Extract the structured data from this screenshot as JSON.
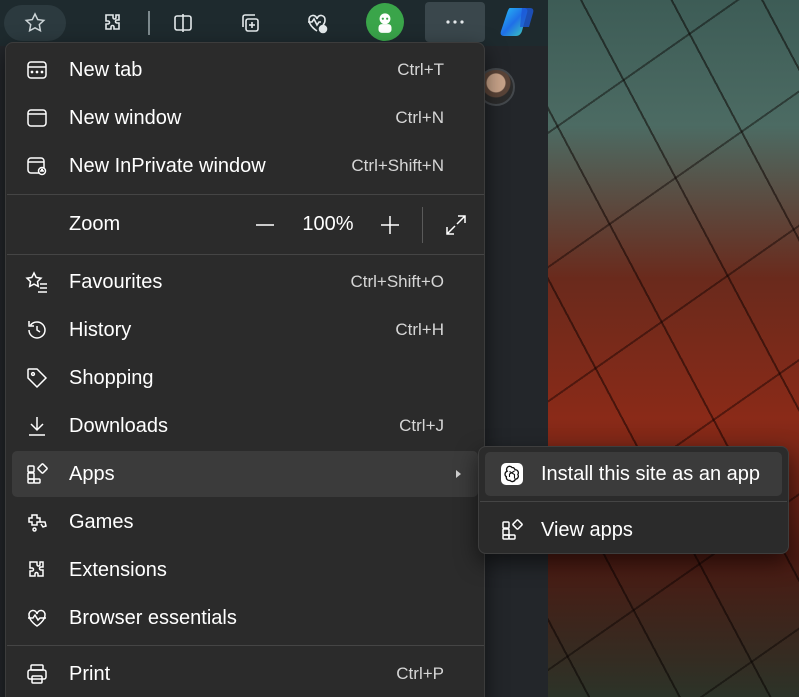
{
  "menu": {
    "items": [
      {
        "label": "New tab",
        "shortcut": "Ctrl+T",
        "icon": "new-tab-icon"
      },
      {
        "label": "New window",
        "shortcut": "Ctrl+N",
        "icon": "new-window-icon"
      },
      {
        "label": "New InPrivate window",
        "shortcut": "Ctrl+Shift+N",
        "icon": "inprivate-icon"
      },
      {
        "label": "Favourites",
        "shortcut": "Ctrl+Shift+O",
        "icon": "favourites-icon"
      },
      {
        "label": "History",
        "shortcut": "Ctrl+H",
        "icon": "history-icon"
      },
      {
        "label": "Shopping",
        "shortcut": "",
        "icon": "shopping-tag-icon"
      },
      {
        "label": "Downloads",
        "shortcut": "Ctrl+J",
        "icon": "download-icon"
      },
      {
        "label": "Apps",
        "shortcut": "",
        "icon": "apps-icon"
      },
      {
        "label": "Games",
        "shortcut": "",
        "icon": "games-icon"
      },
      {
        "label": "Extensions",
        "shortcut": "",
        "icon": "extensions-icon"
      },
      {
        "label": "Browser essentials",
        "shortcut": "",
        "icon": "heart-pulse-icon"
      },
      {
        "label": "Print",
        "shortcut": "Ctrl+P",
        "icon": "printer-icon"
      }
    ],
    "zoom": {
      "label": "Zoom",
      "value": "100%",
      "out_icon": "minus-icon",
      "in_icon": "plus-icon",
      "fullscreen_icon": "fullscreen-icon"
    }
  },
  "apps_submenu": {
    "items": [
      {
        "label": "Install this site as an app",
        "icon": "openai-logo-icon"
      },
      {
        "label": "View apps",
        "icon": "apps-icon"
      }
    ]
  },
  "toolbar": {
    "icons": [
      "star-icon",
      "extensions-icon",
      "split-screen-icon",
      "collections-icon",
      "browser-essentials-icon",
      "profile-avatar-icon",
      "more-icon",
      "copilot-icon"
    ]
  },
  "colors": {
    "menu_bg": "#2b2b2b",
    "highlight": "#3b3b3b",
    "text": "#ffffff",
    "toolbar_bg": "#1e2a2e",
    "avatar_green": "#3aa54a"
  }
}
